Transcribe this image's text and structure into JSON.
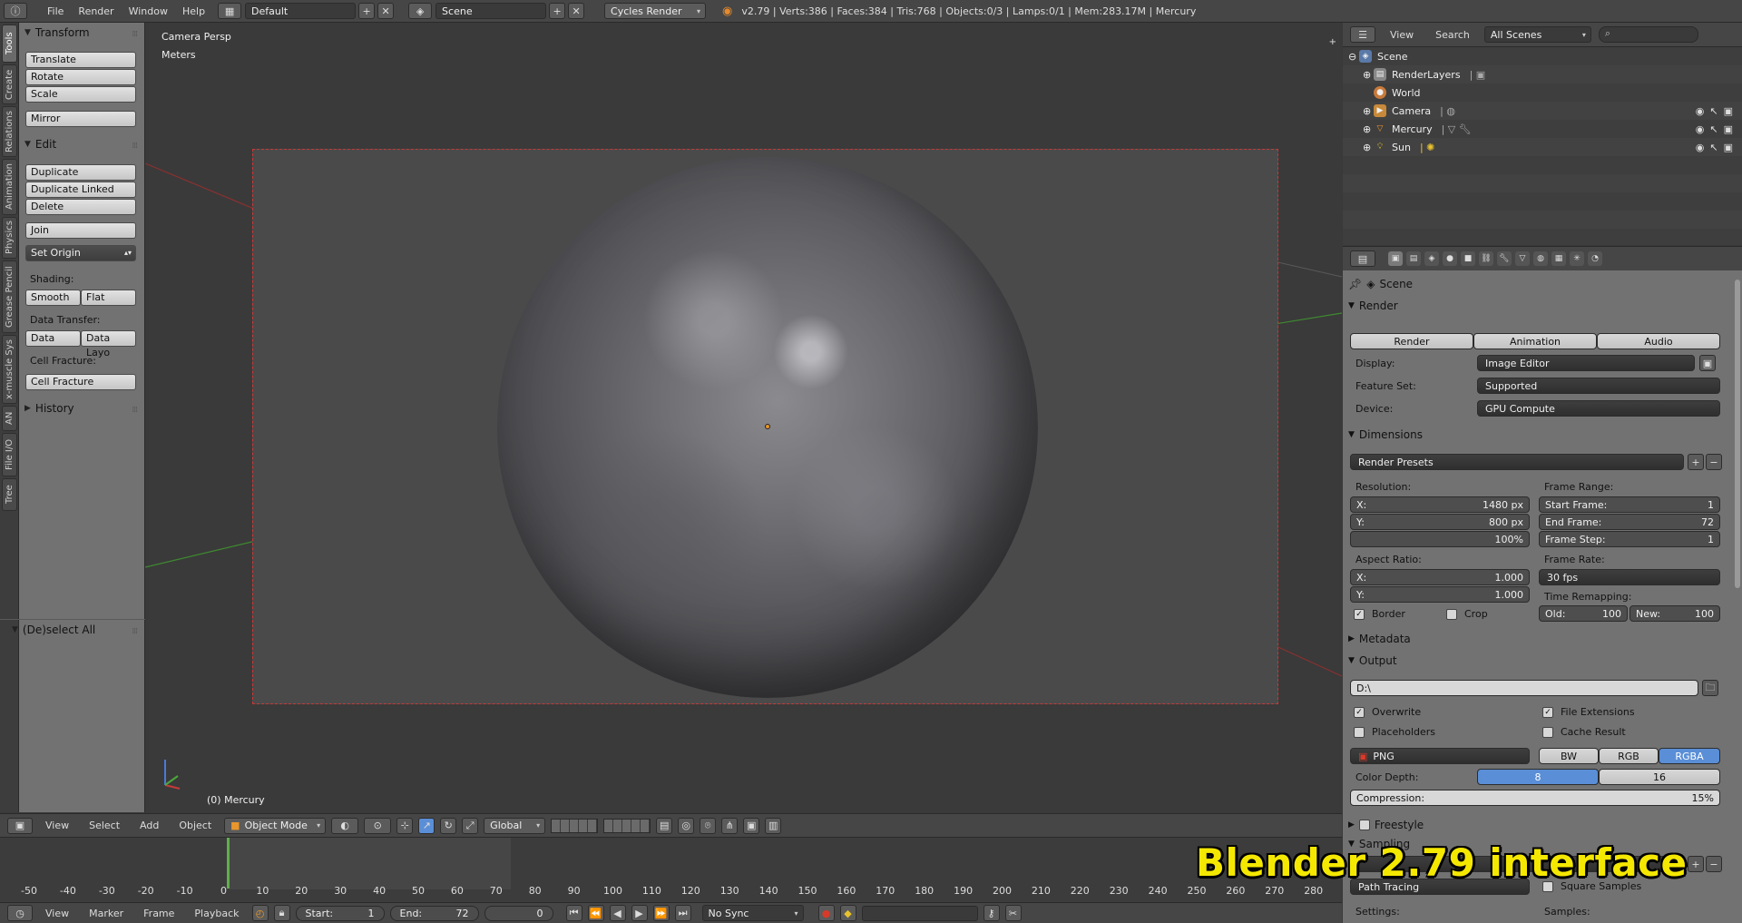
{
  "topbar": {
    "menus": [
      "File",
      "Render",
      "Window",
      "Help"
    ],
    "layout": "Default",
    "scene": "Scene",
    "engine": "Cycles Render",
    "stats": "v2.79 | Verts:386 | Faces:384 | Tris:768 | Objects:0/3 | Lamps:0/1 | Mem:283.17M | Mercury"
  },
  "tabs": [
    "Tools",
    "Create",
    "Relations",
    "Animation",
    "Physics",
    "Grease Pencil",
    "x-muscle Sys",
    "AN",
    "File I/O",
    "Tree"
  ],
  "toolshelf": {
    "transform": {
      "title": "Transform",
      "buttons": [
        "Translate",
        "Rotate",
        "Scale",
        "Mirror"
      ]
    },
    "edit": {
      "title": "Edit",
      "buttons": [
        "Duplicate",
        "Duplicate Linked",
        "Delete",
        "Join"
      ],
      "set_origin": "Set Origin"
    },
    "shading": {
      "label": "Shading:",
      "smooth": "Smooth",
      "flat": "Flat"
    },
    "data_transfer": {
      "label": "Data Transfer:",
      "data": "Data",
      "data_layout": "Data Layo"
    },
    "cell_fracture": {
      "label": "Cell Fracture:",
      "button": "Cell Fracture"
    },
    "history": "History",
    "deselect": "(De)select All"
  },
  "viewport": {
    "view_name": "Camera Persp",
    "units": "Meters",
    "object_label": "(0) Mercury"
  },
  "view3d_header": {
    "menus": [
      "View",
      "Select",
      "Add",
      "Object"
    ],
    "mode": "Object Mode",
    "orientation": "Global"
  },
  "timeline": {
    "ticks": [
      "-50",
      "-40",
      "-30",
      "-20",
      "-10",
      "0",
      "10",
      "20",
      "30",
      "40",
      "50",
      "60",
      "70",
      "80",
      "90",
      "100",
      "110",
      "120",
      "130",
      "140",
      "150",
      "160",
      "170",
      "180",
      "190",
      "200",
      "210",
      "220",
      "230",
      "240",
      "250",
      "260",
      "270",
      "280"
    ],
    "menus": [
      "View",
      "Marker",
      "Frame",
      "Playback"
    ],
    "start_label": "Start:",
    "start": "1",
    "end_label": "End:",
    "end": "72",
    "current": "0",
    "sync": "No Sync"
  },
  "outliner": {
    "menus": [
      "View",
      "Search"
    ],
    "filter": "All Scenes",
    "items": [
      "Scene",
      "RenderLayers",
      "World",
      "Camera",
      "Mercury",
      "Sun"
    ]
  },
  "properties": {
    "context": "Scene",
    "render": {
      "title": "Render",
      "render_btn": "Render",
      "animation_btn": "Animation",
      "audio_btn": "Audio",
      "display_label": "Display:",
      "display": "Image Editor",
      "feature_label": "Feature Set:",
      "feature": "Supported",
      "device_label": "Device:",
      "device": "GPU Compute"
    },
    "dimensions": {
      "title": "Dimensions",
      "presets": "Render Presets",
      "resolution_label": "Resolution:",
      "res_x_label": "X:",
      "res_x": "1480 px",
      "res_y_label": "Y:",
      "res_y": "800 px",
      "res_pct": "100%",
      "frame_range_label": "Frame Range:",
      "start_frame_label": "Start Frame:",
      "start_frame": "1",
      "end_frame_label": "End Frame:",
      "end_frame": "72",
      "frame_step_label": "Frame Step:",
      "frame_step": "1",
      "aspect_label": "Aspect Ratio:",
      "aspect_x_label": "X:",
      "aspect_x": "1.000",
      "aspect_y_label": "Y:",
      "aspect_y": "1.000",
      "frame_rate_label": "Frame Rate:",
      "frame_rate": "30 fps",
      "time_remap_label": "Time Remapping:",
      "old_label": "Old:",
      "old": "100",
      "new_label": "New:",
      "new": "100",
      "border": "Border",
      "crop": "Crop"
    },
    "metadata": "Metadata",
    "output": {
      "title": "Output",
      "path": "D:\\",
      "overwrite": "Overwrite",
      "file_ext": "File Extensions",
      "placeholders": "Placeholders",
      "cache": "Cache Result",
      "format": "PNG",
      "bw": "BW",
      "rgb": "RGB",
      "rgba": "RGBA",
      "depth_label": "Color Depth:",
      "depth_8": "8",
      "depth_16": "16",
      "compression_label": "Compression:",
      "compression": "15%"
    },
    "freestyle": "Freestyle",
    "sampling": {
      "title": "Sampling",
      "integrator": "Path Tracing",
      "square": "Square Samples",
      "settings_label": "Settings:",
      "samples_label": "Samples:"
    }
  },
  "overlay_caption": "Blender 2.79 interface",
  "colors": {
    "accent_blue": "#5a8ed6",
    "caption_yellow": "#f5e800",
    "timeline_cursor": "#5fb04a"
  }
}
